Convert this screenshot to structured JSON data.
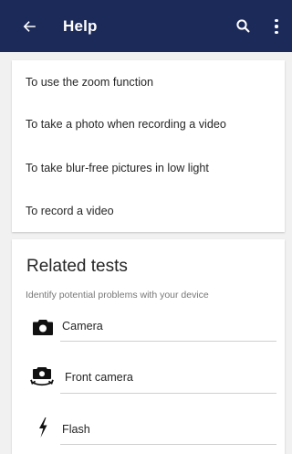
{
  "header": {
    "title": "Help",
    "back_icon": "arrow-back-icon",
    "search_icon": "search-icon",
    "more_icon": "more-vert-icon",
    "background": "#1c2a5a"
  },
  "help_topics": [
    {
      "label": "To use the zoom function"
    },
    {
      "label": "To take a photo when recording a video"
    },
    {
      "label": "To take blur-free pictures in low light"
    },
    {
      "label": "To record a video"
    }
  ],
  "related_tests": {
    "title": "Related tests",
    "subtitle": "Identify potential problems with your device",
    "items": [
      {
        "label": "Camera",
        "icon": "camera-icon"
      },
      {
        "label": "Front camera",
        "icon": "front-camera-icon"
      },
      {
        "label": "Flash",
        "icon": "flash-icon"
      }
    ]
  }
}
